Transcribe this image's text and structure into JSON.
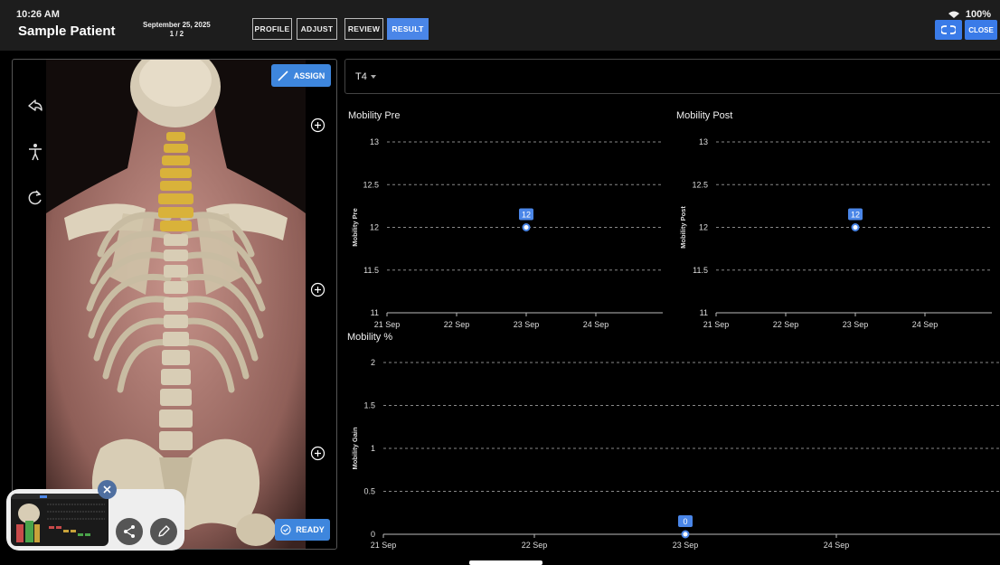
{
  "status_bar": {
    "time": "10:26 AM",
    "battery": "100%"
  },
  "header": {
    "patient_name": "Sample Patient",
    "date": "September 25, 2025",
    "page": "1 / 2",
    "tabs": [
      {
        "label": "PROFILE",
        "active": false
      },
      {
        "label": "ADJUST",
        "active": false
      },
      {
        "label": "REVIEW",
        "active": false
      },
      {
        "label": "RESULT",
        "active": true
      }
    ],
    "close_label": "CLOSE",
    "link_icon": "link-icon"
  },
  "left_panel": {
    "assign_label": "ASSIGN",
    "ready_label": "READY",
    "side_icons": [
      "undo-icon",
      "person-icon",
      "refresh-icon"
    ],
    "add_icons": [
      "add-circle-icon",
      "add-circle-icon",
      "add-circle-icon"
    ]
  },
  "selector": {
    "value": "T4"
  },
  "charts": {
    "pre": {
      "title": "Mobility Pre"
    },
    "post": {
      "title": "Mobility Post"
    },
    "pct": {
      "title": "Mobility %"
    }
  },
  "chart_data": [
    {
      "type": "scatter",
      "title": "Mobility Pre",
      "ylabel": "Mobility Pre",
      "xlabel": "",
      "x_ticks": [
        "21 Sep",
        "22 Sep",
        "23 Sep",
        "24 Sep"
      ],
      "y_ticks": [
        "11",
        "11.5",
        "12",
        "12.5",
        "13"
      ],
      "ylim": [
        11,
        13
      ],
      "series": [
        {
          "x": [
            "23 Sep"
          ],
          "values": [
            12
          ],
          "labels": [
            "12"
          ]
        }
      ],
      "grid": true,
      "color": "#4a86e8"
    },
    {
      "type": "scatter",
      "title": "Mobility Post",
      "ylabel": "Mobility Post",
      "xlabel": "",
      "x_ticks": [
        "21 Sep",
        "22 Sep",
        "23 Sep",
        "24 Sep"
      ],
      "y_ticks": [
        "11",
        "11.5",
        "12",
        "12.5",
        "13"
      ],
      "ylim": [
        11,
        13
      ],
      "series": [
        {
          "x": [
            "23 Sep"
          ],
          "values": [
            12
          ],
          "labels": [
            "12"
          ]
        }
      ],
      "grid": true,
      "color": "#4a86e8"
    },
    {
      "type": "scatter",
      "title": "Mobility %",
      "ylabel": "Mobility Gain",
      "xlabel": "",
      "x_ticks": [
        "21 Sep",
        "22 Sep",
        "23 Sep",
        "24 Sep"
      ],
      "y_ticks": [
        "0",
        "0.5",
        "1",
        "1.5",
        "2"
      ],
      "ylim": [
        0,
        2
      ],
      "series": [
        {
          "x": [
            "23 Sep"
          ],
          "values": [
            0
          ],
          "labels": [
            "0"
          ]
        }
      ],
      "grid": true,
      "color": "#4a86e8"
    }
  ],
  "share_icons": [
    "share-icon",
    "edit-icon"
  ],
  "colors": {
    "accent": "#4a86e8",
    "spine_highlight": "#d9b23a"
  }
}
